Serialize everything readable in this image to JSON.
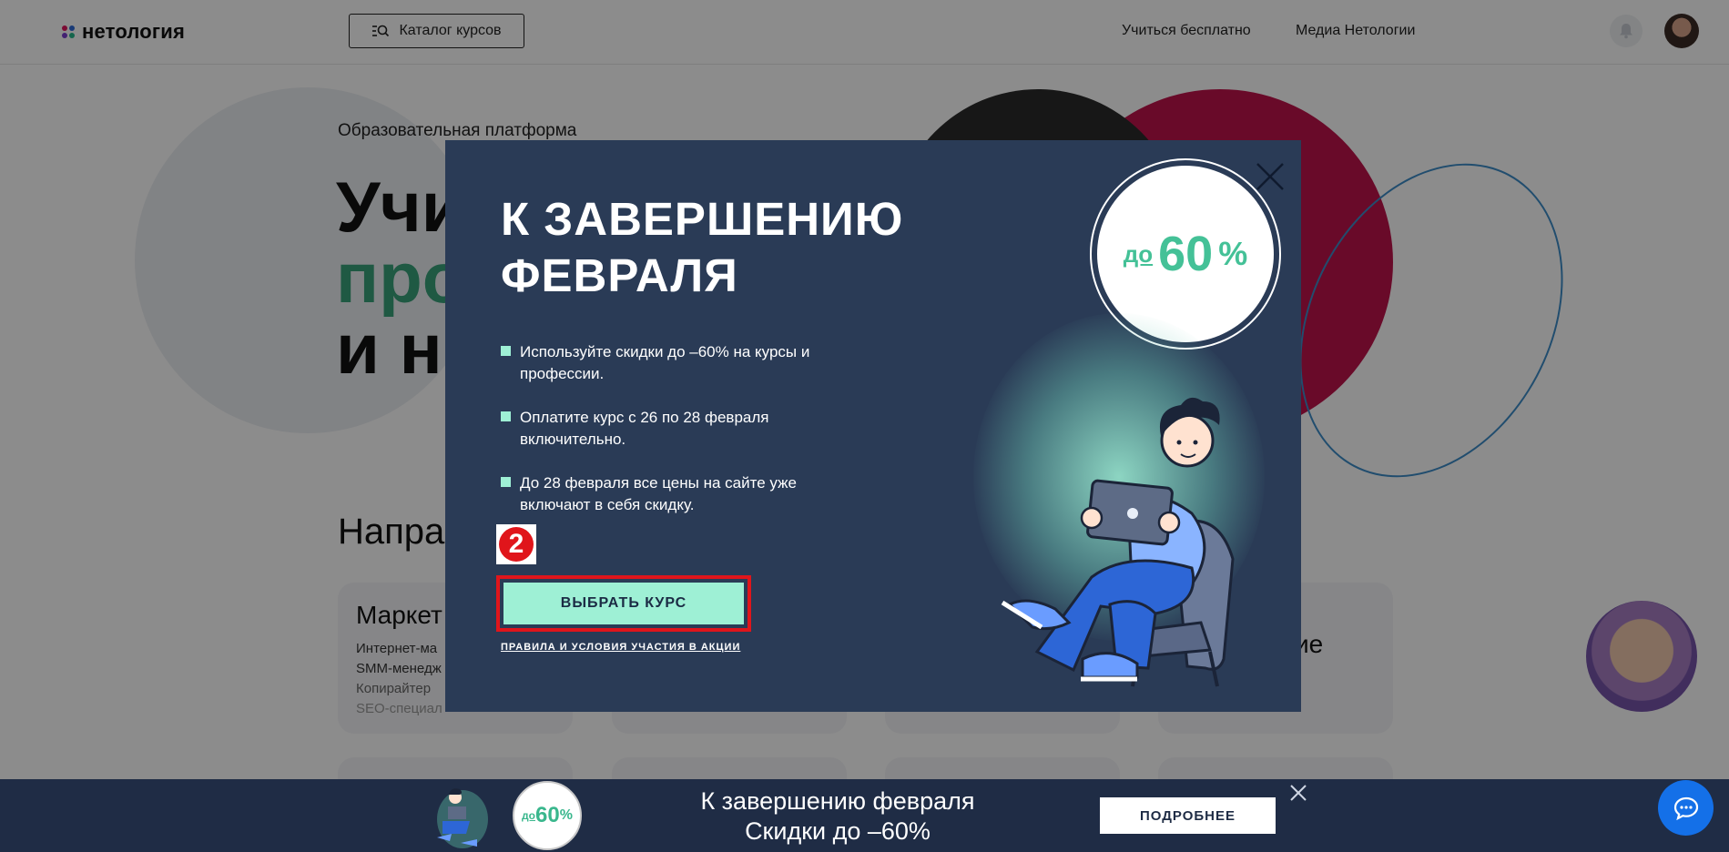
{
  "header": {
    "logo_text": "нетология",
    "catalog_label": "Каталог курсов",
    "nav": [
      "Учиться бесплатно",
      "Медиа Нетологии"
    ]
  },
  "hero": {
    "subtitle": "Образовательная платформа",
    "line1": "Учи",
    "line2": "про",
    "line3": "и н"
  },
  "directions": {
    "title": "Напра",
    "card1": {
      "title": "Маркет",
      "lines": [
        "Интернет-ма",
        "SMM-менедж",
        "Копирайтер",
        "SEO-специал"
      ]
    },
    "card4": {
      "title": "ие"
    }
  },
  "modal": {
    "title_line1": "К ЗАВЕРШЕНИЮ",
    "title_line2": "ФЕВРАЛЯ",
    "bullets": [
      "Используйте скидки до –60% на курсы и профессии.",
      "Оплатите курс с 26 по 28 февраля включительно.",
      "До 28 февраля все цены на сайте уже включают в себя скидку."
    ],
    "annotation_number": "2",
    "cta_label": "ВЫБРАТЬ КУРС",
    "rules_label": "ПРАВИЛА И УСЛОВИЯ УЧАСТИЯ В АКЦИИ",
    "disc_do": "до",
    "disc_number": "60",
    "disc_percent": "%"
  },
  "banner": {
    "disc_do": "до",
    "disc_number": "60",
    "disc_percent": "%",
    "line1": "К завершению февраля",
    "line2": "Скидки до –60%",
    "button_label": "ПОДРОБНЕЕ"
  },
  "colors": {
    "modal_bg": "#2a3b56",
    "accent_mint": "#9ef0d5",
    "discount_green": "#44c197",
    "highlight_red": "#e0151b",
    "banner_bg": "#1f2c45",
    "chat_blue": "#1470e8"
  }
}
